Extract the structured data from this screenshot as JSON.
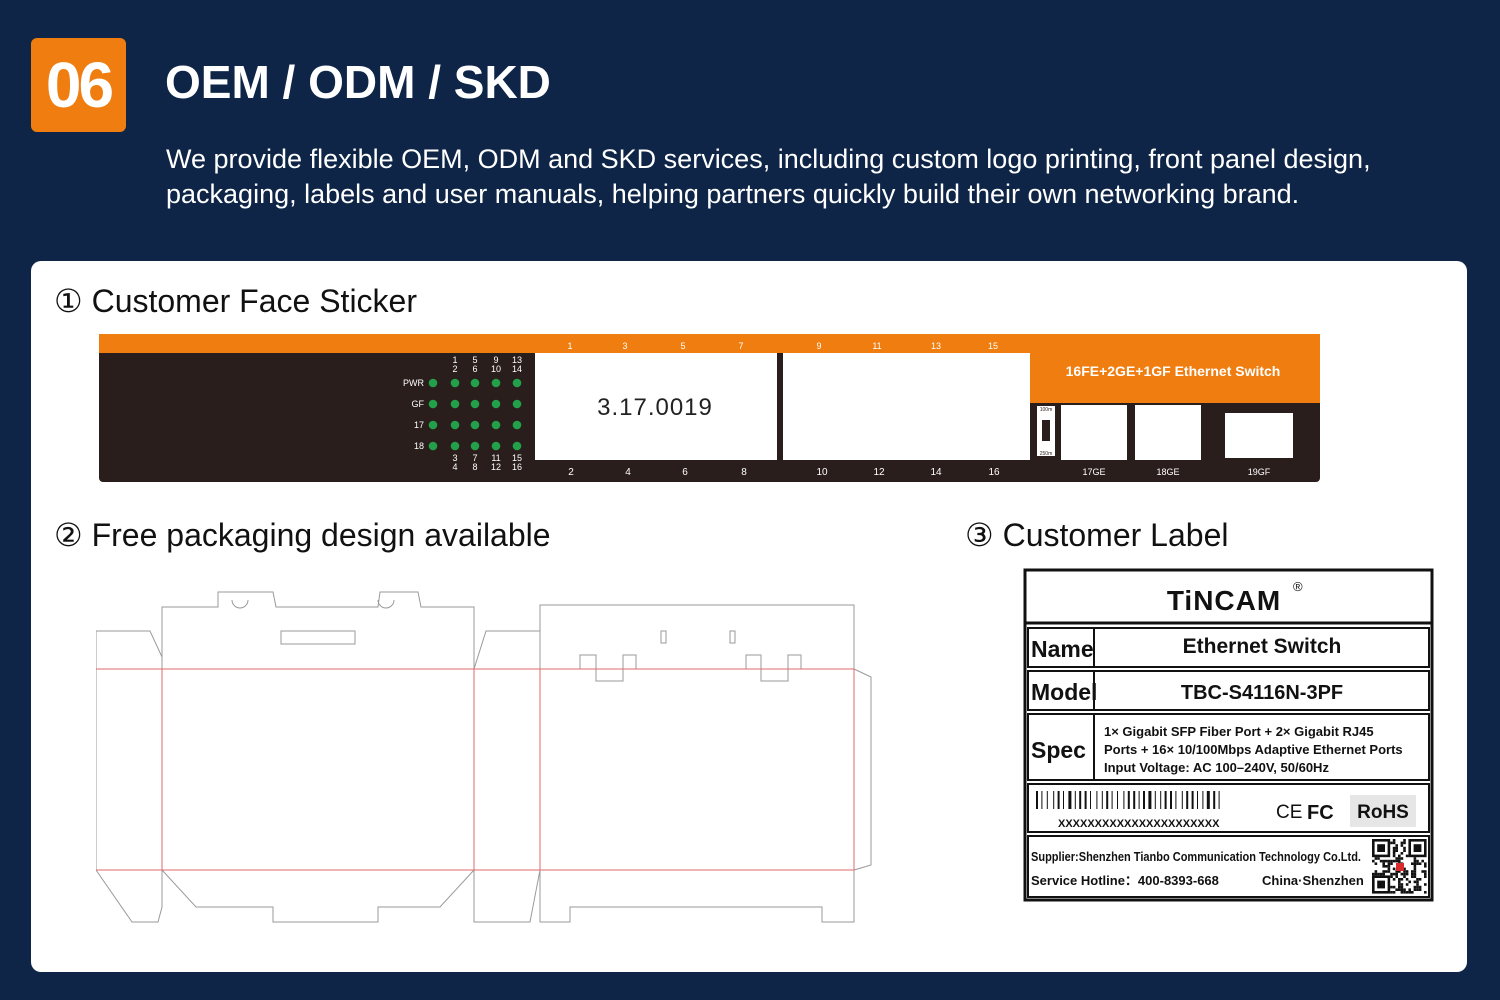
{
  "header": {
    "badge": "06",
    "title": "OEM / ODM / SKD",
    "description": "We provide flexible OEM, ODM and SKD services, including custom logo printing, front panel design, packaging, labels and user manuals, helping partners quickly build their own networking brand."
  },
  "sections": {
    "sticker_title": "① Customer Face Sticker",
    "packaging_title": "② Free packaging design available",
    "label_title": "③  Customer Label"
  },
  "sticker": {
    "led_top_nums": [
      [
        "1",
        "2"
      ],
      [
        "5",
        "6"
      ],
      [
        "9",
        "10"
      ],
      [
        "13",
        "14"
      ]
    ],
    "led_bottom_nums": [
      [
        "3",
        "4"
      ],
      [
        "7",
        "8"
      ],
      [
        "11",
        "12"
      ],
      [
        "15",
        "16"
      ]
    ],
    "led_rows": [
      "PWR",
      "GF",
      "17",
      "18"
    ],
    "port_top": [
      "1",
      "3",
      "5",
      "7",
      "9",
      "11",
      "13",
      "15"
    ],
    "port_bottom": [
      "2",
      "4",
      "6",
      "8",
      "10",
      "12",
      "14",
      "16"
    ],
    "version": "3.17.0019",
    "model_desc": "16FE+2GE+1GF Ethernet Switch",
    "switch_top": "100m",
    "switch_bottom": "250m",
    "uplinks": [
      "17GE",
      "18GE",
      "19GF"
    ],
    "colors": {
      "orange": "#ef7d0f",
      "dark": "#2a1e1c",
      "led": "#22a04a"
    }
  },
  "label": {
    "brand": "TiNCAM",
    "registered": "®",
    "rows": [
      {
        "key": "Name",
        "value": "Ethernet Switch"
      },
      {
        "key": "Model",
        "value": "TBC-S4116N-3PF"
      }
    ],
    "spec_key": "Spec",
    "spec_lines": [
      "1× Gigabit SFP Fiber Port + 2× Gigabit RJ45",
      "Ports + 16× 10/100Mbps Adaptive Ethernet Ports",
      "Input Voltage: AC 100–240V, 50/60Hz"
    ],
    "barcode_text": "XXXXXXXXXXXXXXXXXXXXXX",
    "cert_ce": "CE",
    "cert_fc": "FC",
    "cert_rohs": "RoHS",
    "supplier": "Supplier:Shenzhen Tianbo Communication Technology Co.Ltd.",
    "hotline": "Service Hotline：400-8393-668",
    "origin": "China·Shenzhen"
  }
}
